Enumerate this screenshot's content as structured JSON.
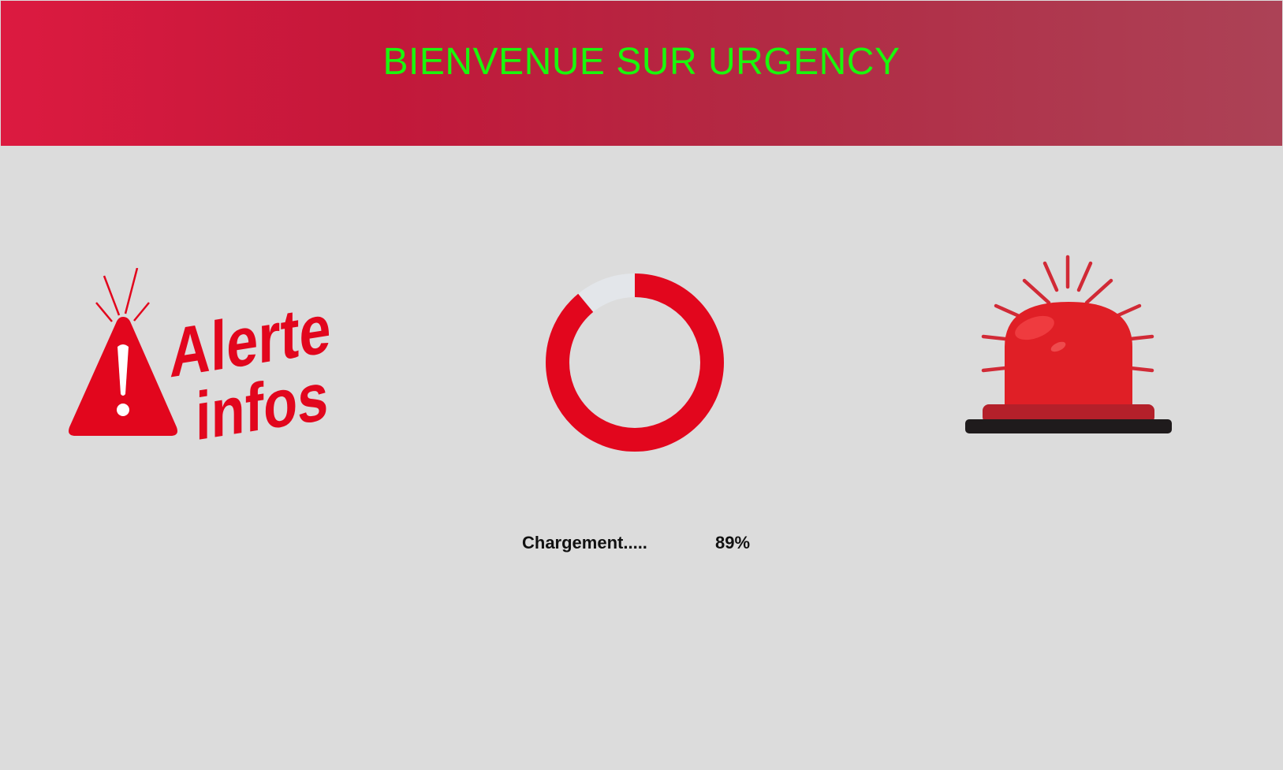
{
  "header": {
    "title": "BIENVENUE SUR URGENCY"
  },
  "logo": {
    "word1": "Alerte",
    "word2": "infos",
    "icon": "warning-triangle-icon"
  },
  "loader": {
    "label": "Chargement.....",
    "percent_text": "89%",
    "progress": 0.89,
    "color": "#e2061d",
    "track_color": "#e3e6ea"
  },
  "siren": {
    "icon": "siren-icon"
  },
  "colors": {
    "header_start": "#dc1a40",
    "header_end": "#ac4256",
    "title": "#1af70c",
    "background": "#dcdcdc",
    "accent_red": "#e2061d"
  }
}
